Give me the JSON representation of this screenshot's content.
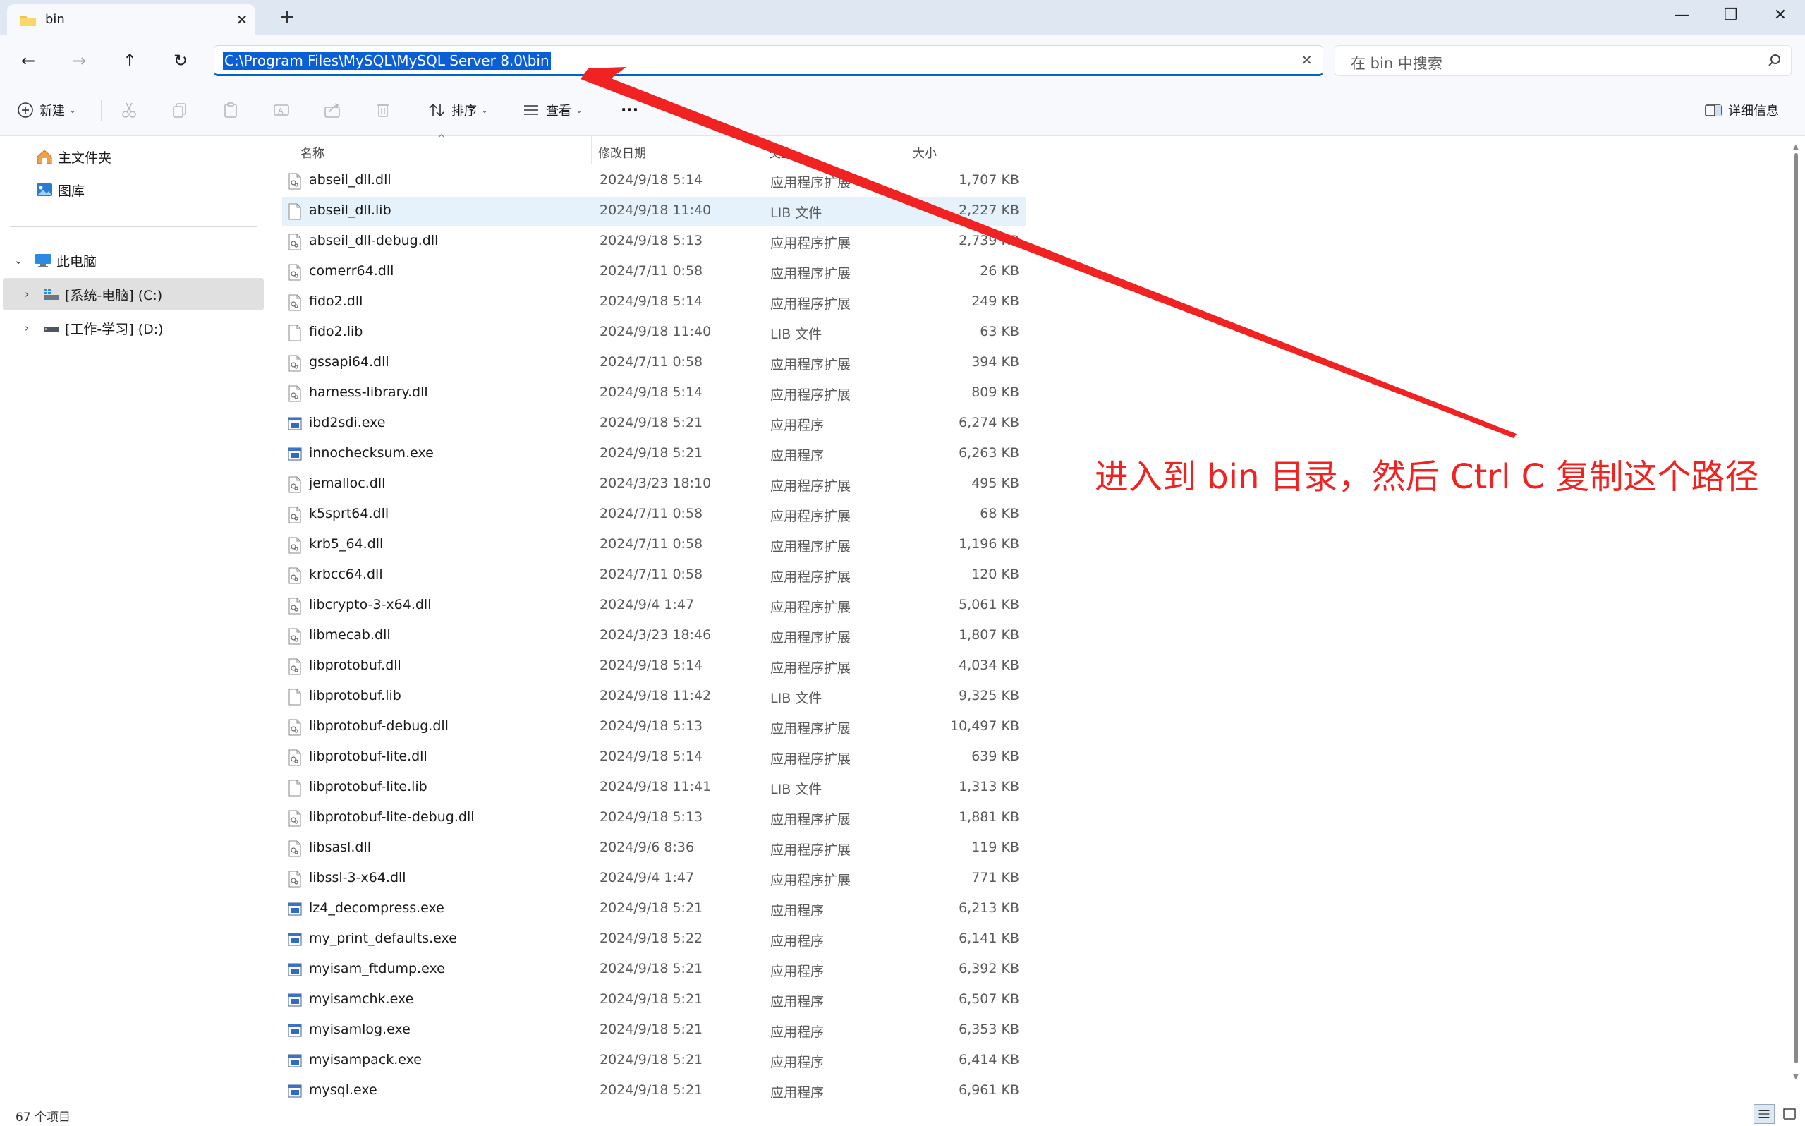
{
  "window": {
    "tab_title": "bin",
    "tab_close": "✕",
    "new_tab": "+",
    "minimize": "—",
    "restore": "❐",
    "close": "✕"
  },
  "navigation": {
    "back": "←",
    "forward": "→",
    "up": "↑",
    "refresh": "↻",
    "address_path": "C:\\Program Files\\MySQL\\MySQL Server 8.0\\bin",
    "address_clear": "✕",
    "search_placeholder": "在 bin 中搜索"
  },
  "toolbar": {
    "new_label": "新建",
    "sort_label": "排序",
    "view_label": "查看",
    "more_label": "···",
    "details_label": "详细信息"
  },
  "sidebar": {
    "items": [
      {
        "label": "主文件夹",
        "icon": "home-icon"
      },
      {
        "label": "图库",
        "icon": "gallery-icon"
      },
      {
        "label": "此电脑",
        "icon": "computer-icon",
        "chevron": "⌄"
      },
      {
        "label": "[系统-电脑] (C:)",
        "icon": "drive-icon",
        "chevron": "›"
      },
      {
        "label": "[工作-学习] (D:)",
        "icon": "drive-icon",
        "chevron": "›"
      }
    ]
  },
  "columns": {
    "name": "名称",
    "date": "修改日期",
    "type": "类型",
    "size": "大小"
  },
  "files": [
    {
      "name": "abseil_dll.dll",
      "date": "2024/9/18 5:14",
      "type": "应用程序扩展",
      "size": "1,707 KB",
      "icon": "dll"
    },
    {
      "name": "abseil_dll.lib",
      "date": "2024/9/18 11:40",
      "type": "LIB 文件",
      "size": "2,227 KB",
      "icon": "lib"
    },
    {
      "name": "abseil_dll-debug.dll",
      "date": "2024/9/18 5:13",
      "type": "应用程序扩展",
      "size": "2,739 KB",
      "icon": "dll"
    },
    {
      "name": "comerr64.dll",
      "date": "2024/7/11 0:58",
      "type": "应用程序扩展",
      "size": "26 KB",
      "icon": "dll"
    },
    {
      "name": "fido2.dll",
      "date": "2024/9/18 5:14",
      "type": "应用程序扩展",
      "size": "249 KB",
      "icon": "dll"
    },
    {
      "name": "fido2.lib",
      "date": "2024/9/18 11:40",
      "type": "LIB 文件",
      "size": "63 KB",
      "icon": "lib"
    },
    {
      "name": "gssapi64.dll",
      "date": "2024/7/11 0:58",
      "type": "应用程序扩展",
      "size": "394 KB",
      "icon": "dll"
    },
    {
      "name": "harness-library.dll",
      "date": "2024/9/18 5:14",
      "type": "应用程序扩展",
      "size": "809 KB",
      "icon": "dll"
    },
    {
      "name": "ibd2sdi.exe",
      "date": "2024/9/18 5:21",
      "type": "应用程序",
      "size": "6,274 KB",
      "icon": "exe"
    },
    {
      "name": "innochecksum.exe",
      "date": "2024/9/18 5:21",
      "type": "应用程序",
      "size": "6,263 KB",
      "icon": "exe"
    },
    {
      "name": "jemalloc.dll",
      "date": "2024/3/23 18:10",
      "type": "应用程序扩展",
      "size": "495 KB",
      "icon": "dll"
    },
    {
      "name": "k5sprt64.dll",
      "date": "2024/7/11 0:58",
      "type": "应用程序扩展",
      "size": "68 KB",
      "icon": "dll"
    },
    {
      "name": "krb5_64.dll",
      "date": "2024/7/11 0:58",
      "type": "应用程序扩展",
      "size": "1,196 KB",
      "icon": "dll"
    },
    {
      "name": "krbcc64.dll",
      "date": "2024/7/11 0:58",
      "type": "应用程序扩展",
      "size": "120 KB",
      "icon": "dll"
    },
    {
      "name": "libcrypto-3-x64.dll",
      "date": "2024/9/4 1:47",
      "type": "应用程序扩展",
      "size": "5,061 KB",
      "icon": "dll"
    },
    {
      "name": "libmecab.dll",
      "date": "2024/3/23 18:46",
      "type": "应用程序扩展",
      "size": "1,807 KB",
      "icon": "dll"
    },
    {
      "name": "libprotobuf.dll",
      "date": "2024/9/18 5:14",
      "type": "应用程序扩展",
      "size": "4,034 KB",
      "icon": "dll"
    },
    {
      "name": "libprotobuf.lib",
      "date": "2024/9/18 11:42",
      "type": "LIB 文件",
      "size": "9,325 KB",
      "icon": "lib"
    },
    {
      "name": "libprotobuf-debug.dll",
      "date": "2024/9/18 5:13",
      "type": "应用程序扩展",
      "size": "10,497 KB",
      "icon": "dll"
    },
    {
      "name": "libprotobuf-lite.dll",
      "date": "2024/9/18 5:14",
      "type": "应用程序扩展",
      "size": "639 KB",
      "icon": "dll"
    },
    {
      "name": "libprotobuf-lite.lib",
      "date": "2024/9/18 11:41",
      "type": "LIB 文件",
      "size": "1,313 KB",
      "icon": "lib"
    },
    {
      "name": "libprotobuf-lite-debug.dll",
      "date": "2024/9/18 5:13",
      "type": "应用程序扩展",
      "size": "1,881 KB",
      "icon": "dll"
    },
    {
      "name": "libsasl.dll",
      "date": "2024/9/6 8:36",
      "type": "应用程序扩展",
      "size": "119 KB",
      "icon": "dll"
    },
    {
      "name": "libssl-3-x64.dll",
      "date": "2024/9/4 1:47",
      "type": "应用程序扩展",
      "size": "771 KB",
      "icon": "dll"
    },
    {
      "name": "lz4_decompress.exe",
      "date": "2024/9/18 5:21",
      "type": "应用程序",
      "size": "6,213 KB",
      "icon": "exe"
    },
    {
      "name": "my_print_defaults.exe",
      "date": "2024/9/18 5:22",
      "type": "应用程序",
      "size": "6,141 KB",
      "icon": "exe"
    },
    {
      "name": "myisam_ftdump.exe",
      "date": "2024/9/18 5:21",
      "type": "应用程序",
      "size": "6,392 KB",
      "icon": "exe"
    },
    {
      "name": "myisamchk.exe",
      "date": "2024/9/18 5:21",
      "type": "应用程序",
      "size": "6,507 KB",
      "icon": "exe"
    },
    {
      "name": "myisamlog.exe",
      "date": "2024/9/18 5:21",
      "type": "应用程序",
      "size": "6,353 KB",
      "icon": "exe"
    },
    {
      "name": "myisampack.exe",
      "date": "2024/9/18 5:21",
      "type": "应用程序",
      "size": "6,414 KB",
      "icon": "exe"
    },
    {
      "name": "mysql.exe",
      "date": "2024/9/18 5:21",
      "type": "应用程序",
      "size": "6,961 KB",
      "icon": "exe"
    }
  ],
  "highlighted_row": 1,
  "status": {
    "item_count": "67 个项目"
  },
  "annotation": {
    "text": "进入到 bin 目录，然后 Ctrl C 复制这个路径",
    "color": "#f12222"
  },
  "colors": {
    "accent": "#0067c0",
    "selection": "#0a5fd6",
    "row_highlight": "#e5f1fb",
    "annotation": "#f12222"
  }
}
